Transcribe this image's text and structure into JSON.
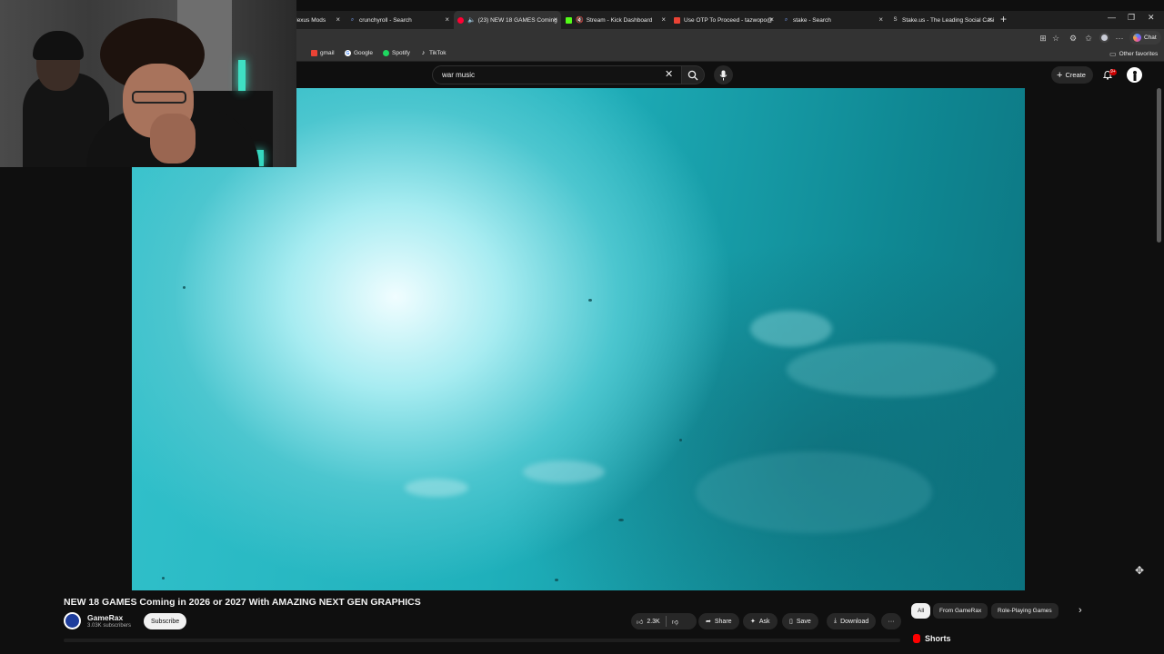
{
  "browser": {
    "tabs": [
      {
        "title": "Nexus Mods",
        "favicon": "nexus-icon"
      },
      {
        "title": "crunchyroll - Search",
        "favicon": "search-icon"
      },
      {
        "title": "(23) NEW 18 GAMES Coming",
        "favicon": "youtube-icon",
        "active": true,
        "audio": true
      },
      {
        "title": "Stream - Kick Dashboard",
        "favicon": "kick-icon",
        "muted": true
      },
      {
        "title": "Use OTP To Proceed - tazwopo@",
        "favicon": "gmail-icon"
      },
      {
        "title": "stake - Search",
        "favicon": "search-icon"
      },
      {
        "title": "Stake.us - The Leading Social Casi",
        "favicon": "stake-icon"
      }
    ],
    "new_tab": "+",
    "chat_label": "Chat",
    "bookmarks": [
      {
        "label": "gmail",
        "icon": "gmail-icon"
      },
      {
        "label": "Google",
        "icon": "google-icon"
      },
      {
        "label": "Spotify",
        "icon": "spotify-icon"
      },
      {
        "label": "TikTok",
        "icon": "tiktok-icon"
      }
    ],
    "other_favorites": "Other favorites"
  },
  "youtube": {
    "search_value": "war music",
    "create_label": "Create",
    "notifications_badge": "9+"
  },
  "video": {
    "title": "NEW 18 GAMES Coming in 2026 or 2027 With AMAZING NEXT GEN GRAPHICS",
    "channel": "GameRax",
    "subscribers": "3.03K subscribers",
    "subscribe_label": "Subscribe",
    "likes": "2.3K",
    "actions": {
      "share": "Share",
      "ask": "Ask",
      "save": "Save",
      "download": "Download"
    }
  },
  "chips": [
    "All",
    "From GameRax",
    "Role-Playing Games"
  ],
  "shorts_label": "Shorts",
  "colors": {
    "background": "#0f0f0f",
    "accent_red": "#cc0000",
    "water_light": "#a7ecf1",
    "water_dark": "#0c7480"
  }
}
